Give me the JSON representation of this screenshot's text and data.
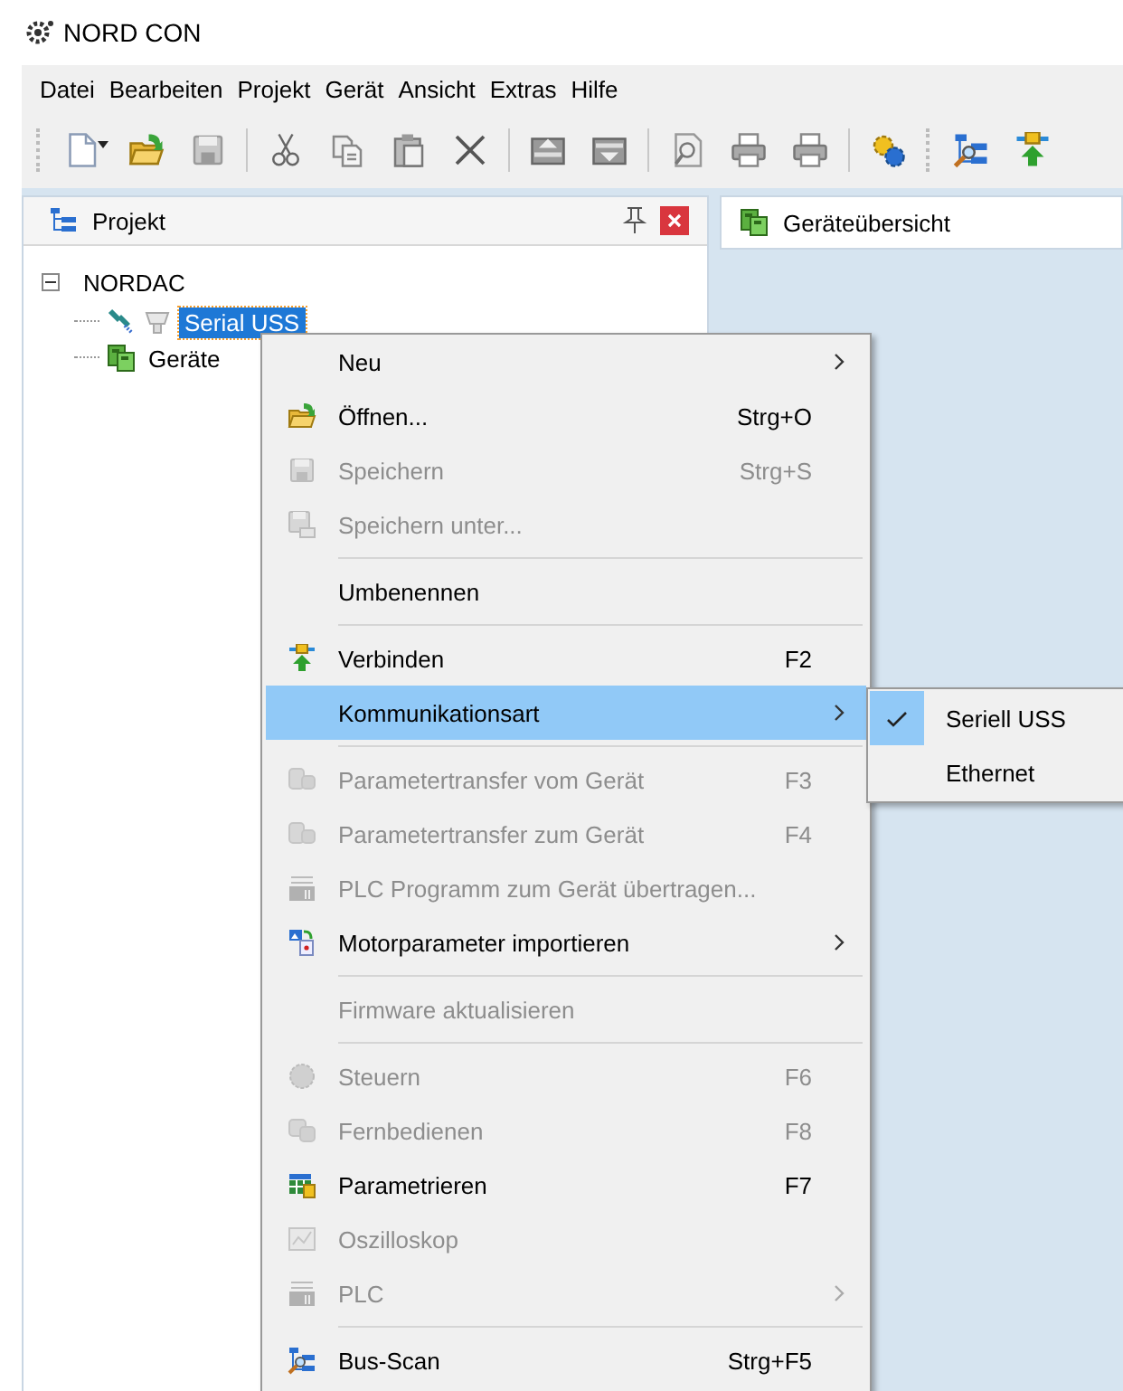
{
  "window": {
    "title": "NORD CON"
  },
  "menu_bar": [
    "Datei",
    "Bearbeiten",
    "Projekt",
    "Gerät",
    "Ansicht",
    "Extras",
    "Hilfe"
  ],
  "project_panel": {
    "title": "Projekt",
    "tree": [
      {
        "label": "NORDAC",
        "expanded": true,
        "selected": false,
        "children": [
          {
            "label": "Serial USS",
            "selected": true
          },
          {
            "label": "Geräte",
            "selected": false
          }
        ]
      }
    ]
  },
  "document_tab": {
    "title": "Geräteübersicht"
  },
  "context_menu": {
    "items": [
      {
        "kind": "item",
        "label": "Neu",
        "disabled": false,
        "submenu": true,
        "selected": false
      },
      {
        "kind": "item",
        "label": "Öffnen...",
        "shortcut": "Strg+O",
        "disabled": false,
        "submenu": false,
        "selected": false
      },
      {
        "kind": "item",
        "label": "Speichern",
        "shortcut": "Strg+S",
        "disabled": true,
        "submenu": false,
        "selected": false
      },
      {
        "kind": "item",
        "label": "Speichern unter...",
        "disabled": true,
        "submenu": false,
        "selected": false
      },
      {
        "kind": "separator"
      },
      {
        "kind": "item",
        "label": "Umbenennen",
        "disabled": false,
        "submenu": false,
        "selected": false
      },
      {
        "kind": "separator"
      },
      {
        "kind": "item",
        "label": "Verbinden",
        "shortcut": "F2",
        "disabled": false,
        "submenu": false,
        "selected": false
      },
      {
        "kind": "item",
        "label": "Kommunikationsart",
        "disabled": false,
        "submenu": true,
        "selected": true
      },
      {
        "kind": "separator"
      },
      {
        "kind": "item",
        "label": "Parametertransfer vom Gerät",
        "shortcut": "F3",
        "disabled": true,
        "submenu": false,
        "selected": false
      },
      {
        "kind": "item",
        "label": "Parametertransfer zum Gerät",
        "shortcut": "F4",
        "disabled": true,
        "submenu": false,
        "selected": false
      },
      {
        "kind": "item",
        "label": "PLC Programm zum Gerät übertragen...",
        "disabled": true,
        "submenu": false,
        "selected": false
      },
      {
        "kind": "item",
        "label": "Motorparameter importieren",
        "disabled": false,
        "submenu": true,
        "selected": false
      },
      {
        "kind": "separator"
      },
      {
        "kind": "item",
        "label": "Firmware aktualisieren",
        "disabled": true,
        "submenu": false,
        "selected": false
      },
      {
        "kind": "separator"
      },
      {
        "kind": "item",
        "label": "Steuern",
        "shortcut": "F6",
        "disabled": true,
        "submenu": false,
        "selected": false
      },
      {
        "kind": "item",
        "label": "Fernbedienen",
        "shortcut": "F8",
        "disabled": true,
        "submenu": false,
        "selected": false
      },
      {
        "kind": "item",
        "label": "Parametrieren",
        "shortcut": "F7",
        "disabled": false,
        "submenu": false,
        "selected": false
      },
      {
        "kind": "item",
        "label": "Oszilloskop",
        "disabled": true,
        "submenu": false,
        "selected": false
      },
      {
        "kind": "item",
        "label": "PLC",
        "disabled": true,
        "submenu": true,
        "selected": false
      },
      {
        "kind": "separator"
      },
      {
        "kind": "item",
        "label": "Bus-Scan",
        "shortcut": "Strg+F5",
        "disabled": false,
        "submenu": false,
        "selected": false
      }
    ]
  },
  "submenu": {
    "items": [
      {
        "label": "Seriell USS",
        "checked": true
      },
      {
        "label": "Ethernet",
        "checked": false
      }
    ]
  }
}
